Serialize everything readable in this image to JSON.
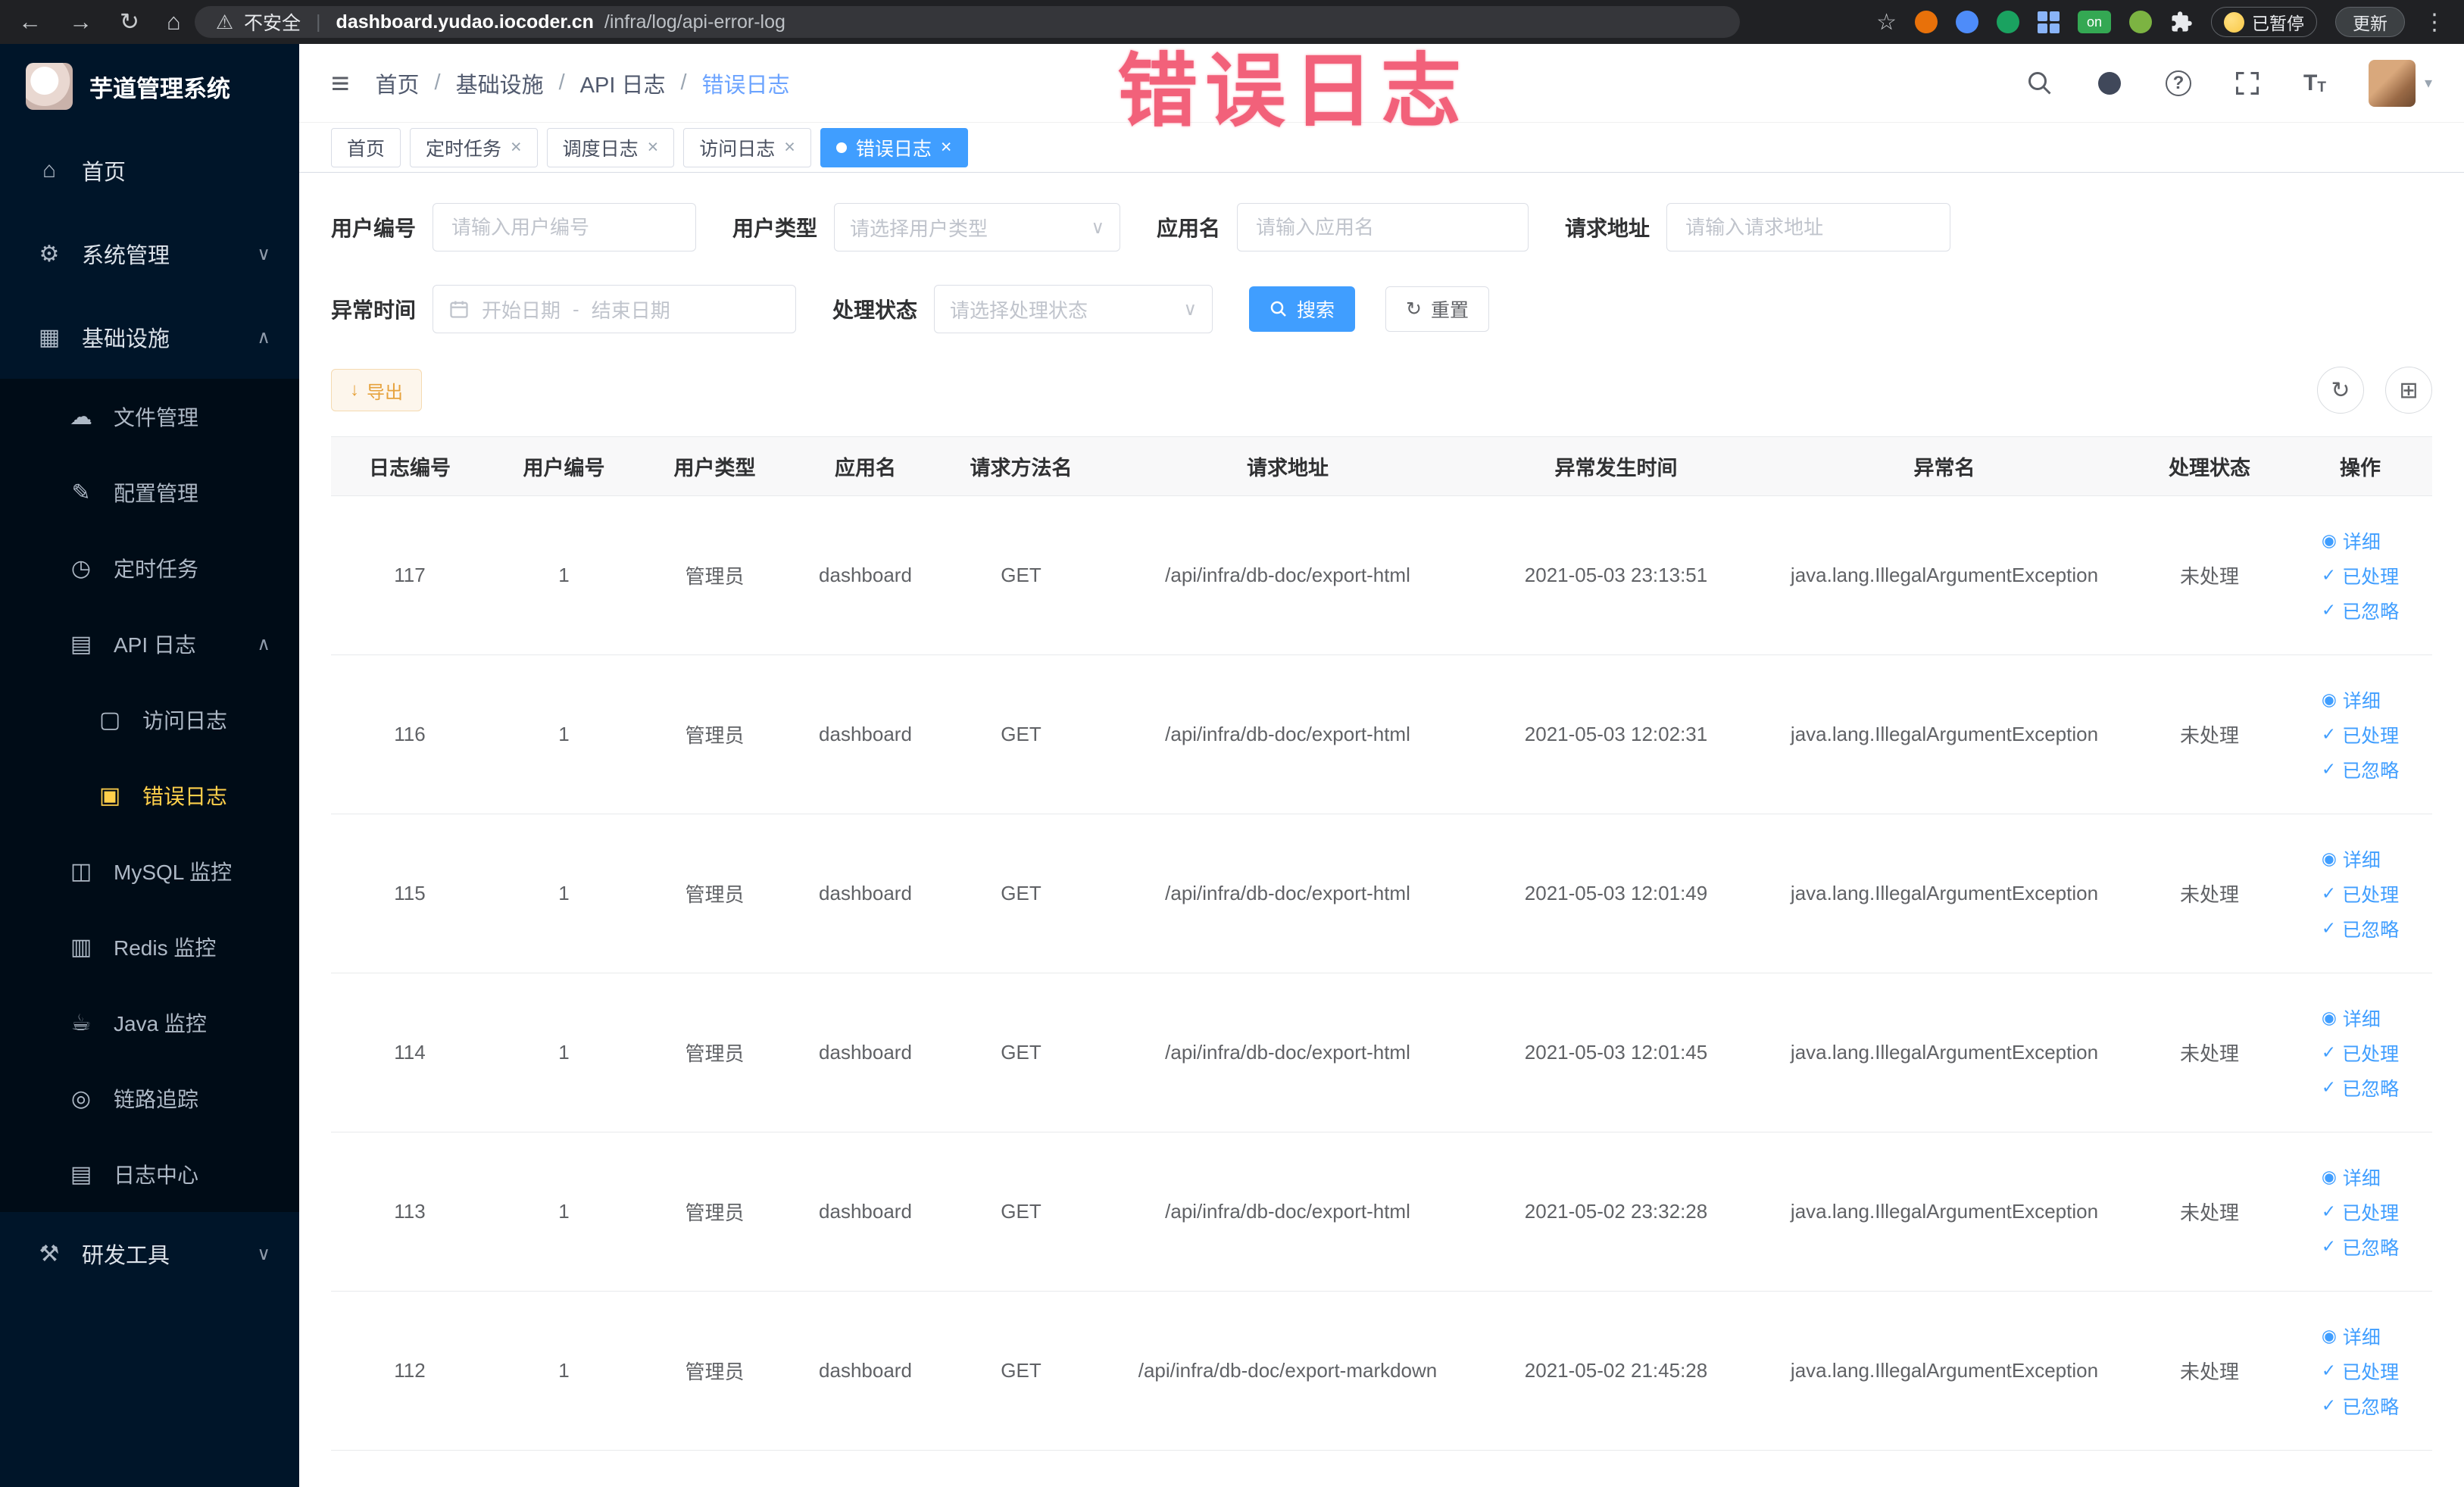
{
  "icons": {
    "back": "←",
    "forward": "→",
    "reload": "↻",
    "home": "⌂",
    "warning": "⚠",
    "star": "☆",
    "kebab": "⋮",
    "hamburger": "≡",
    "chevron_down": "∨",
    "chevron_up": "∧",
    "caret_down": "▾",
    "select_arrow": "∨",
    "close": "×",
    "dot": "●",
    "check": "✓",
    "eye": "◉",
    "download": "↓",
    "refresh": "↻",
    "columns": "⊞",
    "question": "?",
    "font_size": "T",
    "sidebar_home": "⌂",
    "sidebar_system": "⚙",
    "sidebar_infra": "▦",
    "sidebar_file": "☁",
    "sidebar_config": "✎",
    "sidebar_job": "◷",
    "sidebar_apilog": "▤",
    "sidebar_accesslog": "▢",
    "sidebar_errorlog": "▣",
    "sidebar_mysql": "◫",
    "sidebar_redis": "▥",
    "sidebar_java": "☕",
    "sidebar_trace": "◎",
    "sidebar_logcenter": "▤",
    "sidebar_devtools": "⚒"
  },
  "chrome": {
    "security_label": "不安全",
    "divider": "|",
    "url_domain": "dashboard.yudao.iocoder.cn",
    "url_path": "/infra/log/api-error-log",
    "on_badge": "on",
    "paused_badge": "已暂停",
    "update_button": "更新"
  },
  "overlay": {
    "text": "错误日志"
  },
  "sidebar": {
    "logo_title": "芋道管理系统",
    "items": [
      {
        "label": "首页"
      },
      {
        "label": "系统管理"
      },
      {
        "label": "基础设施"
      },
      {
        "label": "文件管理"
      },
      {
        "label": "配置管理"
      },
      {
        "label": "定时任务"
      },
      {
        "label": "API 日志"
      },
      {
        "label": "访问日志"
      },
      {
        "label": "错误日志"
      },
      {
        "label": "MySQL 监控"
      },
      {
        "label": "Redis 监控"
      },
      {
        "label": "Java 监控"
      },
      {
        "label": "链路追踪"
      },
      {
        "label": "日志中心"
      },
      {
        "label": "研发工具"
      }
    ]
  },
  "header": {
    "separator": "/",
    "breadcrumb": [
      "首页",
      "基础设施",
      "API 日志",
      "错误日志"
    ]
  },
  "tabs": [
    {
      "label": "首页"
    },
    {
      "label": "定时任务"
    },
    {
      "label": "调度日志"
    },
    {
      "label": "访问日志"
    },
    {
      "label": "错误日志"
    }
  ],
  "filters": {
    "user_id_label": "用户编号",
    "user_id_placeholder": "请输入用户编号",
    "user_type_label": "用户类型",
    "user_type_placeholder": "请选择用户类型",
    "app_name_label": "应用名",
    "app_name_placeholder": "请输入应用名",
    "request_url_label": "请求地址",
    "request_url_placeholder": "请输入请求地址",
    "exception_time_label": "异常时间",
    "date_start_placeholder": "开始日期",
    "date_separator": "-",
    "date_end_placeholder": "结束日期",
    "process_status_label": "处理状态",
    "process_status_placeholder": "请选择处理状态",
    "search_button": "搜索",
    "reset_button": "重置"
  },
  "toolbar": {
    "export_button": "导出"
  },
  "table": {
    "columns": [
      "日志编号",
      "用户编号",
      "用户类型",
      "应用名",
      "请求方法名",
      "请求地址",
      "异常发生时间",
      "异常名",
      "处理状态",
      "操作"
    ],
    "actions": {
      "detail": "详细",
      "processed": "已处理",
      "ignored": "已忽略"
    },
    "rows": [
      {
        "id": "117",
        "user_id": "1",
        "user_type": "管理员",
        "app": "dashboard",
        "method": "GET",
        "url": "/api/infra/db-doc/export-html",
        "time": "2021-05-03 23:13:51",
        "exception": "java.lang.IllegalArgumentException",
        "status": "未处理"
      },
      {
        "id": "116",
        "user_id": "1",
        "user_type": "管理员",
        "app": "dashboard",
        "method": "GET",
        "url": "/api/infra/db-doc/export-html",
        "time": "2021-05-03 12:02:31",
        "exception": "java.lang.IllegalArgumentException",
        "status": "未处理"
      },
      {
        "id": "115",
        "user_id": "1",
        "user_type": "管理员",
        "app": "dashboard",
        "method": "GET",
        "url": "/api/infra/db-doc/export-html",
        "time": "2021-05-03 12:01:49",
        "exception": "java.lang.IllegalArgumentException",
        "status": "未处理"
      },
      {
        "id": "114",
        "user_id": "1",
        "user_type": "管理员",
        "app": "dashboard",
        "method": "GET",
        "url": "/api/infra/db-doc/export-html",
        "time": "2021-05-03 12:01:45",
        "exception": "java.lang.IllegalArgumentException",
        "status": "未处理"
      },
      {
        "id": "113",
        "user_id": "1",
        "user_type": "管理员",
        "app": "dashboard",
        "method": "GET",
        "url": "/api/infra/db-doc/export-html",
        "time": "2021-05-02 23:32:28",
        "exception": "java.lang.IllegalArgumentException",
        "status": "未处理"
      },
      {
        "id": "112",
        "user_id": "1",
        "user_type": "管理员",
        "app": "dashboard",
        "method": "GET",
        "url": "/api/infra/db-doc/export-markdown",
        "time": "2021-05-02 21:45:28",
        "exception": "java.lang.IllegalArgumentException",
        "status": "未处理"
      }
    ]
  }
}
